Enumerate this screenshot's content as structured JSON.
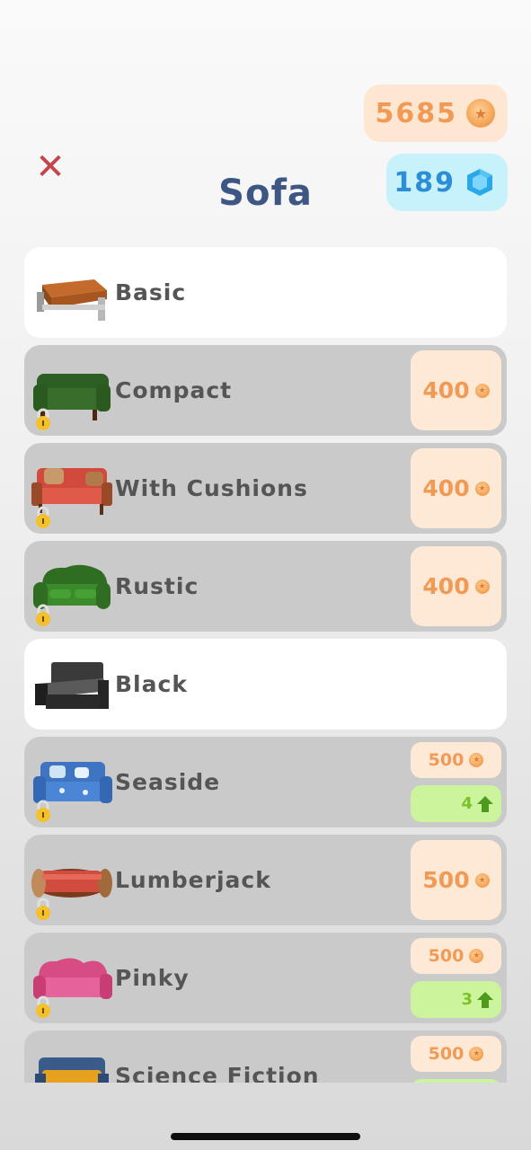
{
  "header": {
    "title": "Sofa",
    "coins": "5685",
    "gems": "189"
  },
  "icons": {
    "close": "close-icon",
    "coin": "coin-icon",
    "gem": "gem-icon",
    "lock": "lock-icon",
    "level_up": "arrow-up-icon"
  },
  "colors": {
    "title": "#3d5784",
    "close": "#c6454d",
    "coin_text": "#f19a55",
    "gem_text": "#2c8ed6",
    "level_text": "#7cc12a"
  },
  "items": [
    {
      "name": "Basic",
      "state": "owned"
    },
    {
      "name": "Compact",
      "state": "locked",
      "price": "400"
    },
    {
      "name": "With Cushions",
      "state": "locked",
      "price": "400"
    },
    {
      "name": "Rustic",
      "state": "locked",
      "price": "400"
    },
    {
      "name": "Black",
      "state": "owned"
    },
    {
      "name": "Seaside",
      "state": "locked",
      "price": "500",
      "level": "4"
    },
    {
      "name": "Lumberjack",
      "state": "locked",
      "price": "500"
    },
    {
      "name": "Pinky",
      "state": "locked",
      "price": "500",
      "level": "3"
    },
    {
      "name": "Science Fiction",
      "state": "locked",
      "price": "500"
    }
  ]
}
